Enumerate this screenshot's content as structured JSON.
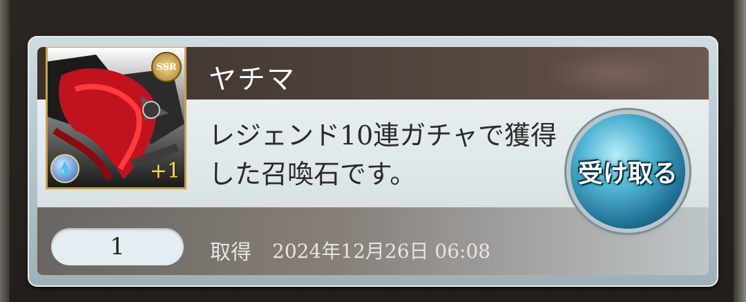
{
  "item": {
    "name": "ヤチマ",
    "description": "レジェンド10連ガチャで獲得した召喚石です。",
    "rarity_badge": "SSR",
    "plus_level": "+1",
    "element_icon": "water-element-icon"
  },
  "quantity": "1",
  "acquired": {
    "label": "取得",
    "date": "2024年12月26日 06:08"
  },
  "actions": {
    "receive_label": "受け取る"
  },
  "colors": {
    "button_blue": "#4fb4d2",
    "name_band": "#3b302b",
    "card_border": "#cfdde2",
    "frame_gold": "#c9a24a"
  }
}
